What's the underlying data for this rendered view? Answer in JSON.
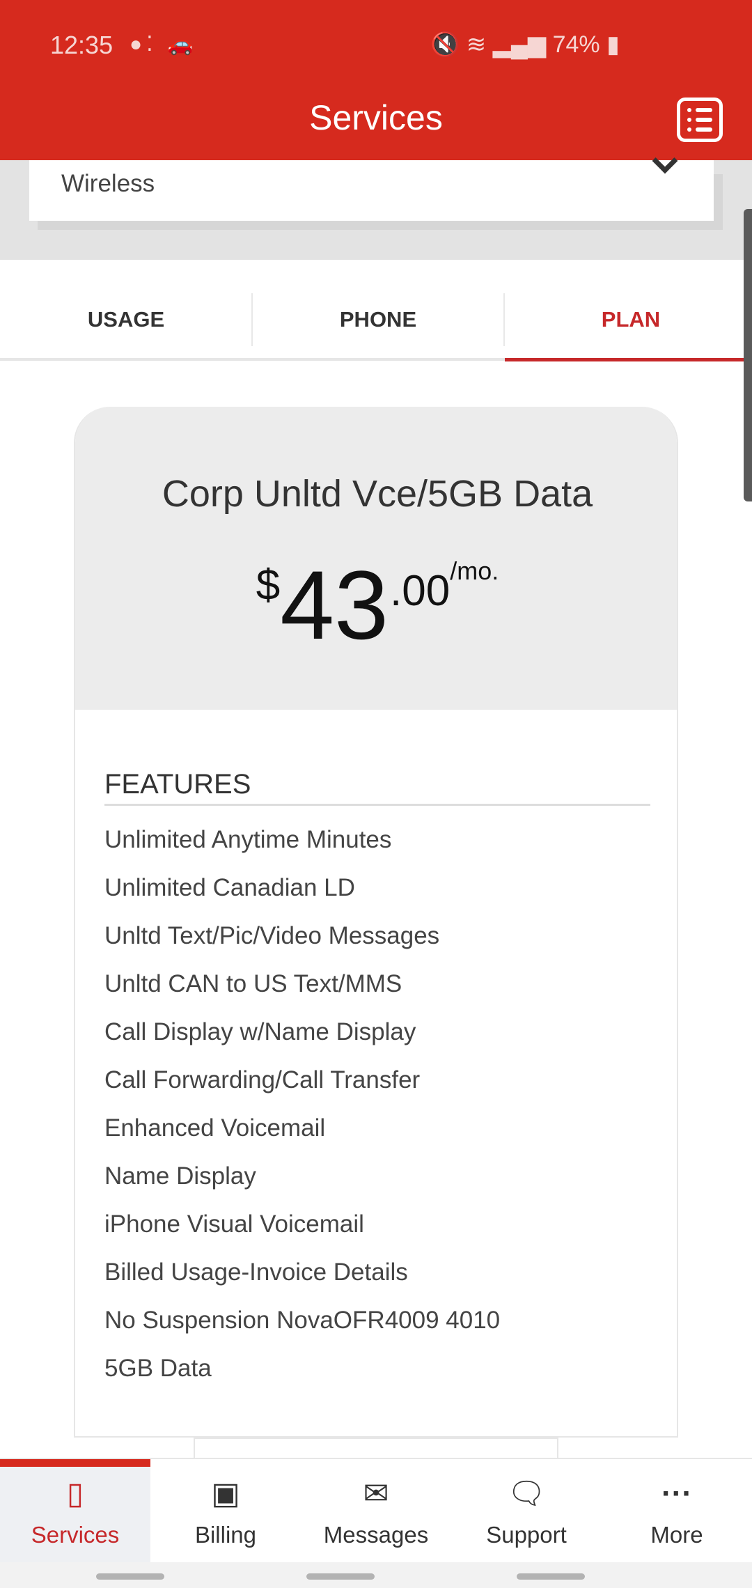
{
  "status_bar": {
    "time": "12:35",
    "battery": "74%",
    "icons": [
      "assistant-icon",
      "car-icon",
      "mute-icon",
      "wifi-icon",
      "signal-icon",
      "battery-icon"
    ]
  },
  "header": {
    "title": "Services",
    "menu_icon": "list-icon"
  },
  "account_select": {
    "value": "Wireless"
  },
  "tabs": [
    {
      "label": "USAGE"
    },
    {
      "label": "PHONE"
    },
    {
      "label": "PLAN",
      "active": true
    }
  ],
  "plan": {
    "name": "Corp Unltd Vce/5GB Data",
    "currency": "$",
    "dollars": "43",
    "cents": ".00",
    "period": "/mo."
  },
  "features": {
    "heading": "FEATURES",
    "items": [
      "Unlimited Anytime Minutes",
      "Unlimited Canadian LD",
      "Unltd Text/Pic/Video Messages",
      "Unltd CAN to US Text/MMS",
      "Call Display w/Name Display",
      "Call Forwarding/Call Transfer",
      "Enhanced Voicemail",
      "Name Display",
      "iPhone Visual Voicemail",
      "Billed Usage-Invoice Details",
      "No Suspension NovaOFR4009 4010",
      "5GB Data"
    ]
  },
  "bottom_nav": [
    {
      "label": "Services",
      "icon": "phone-icon",
      "active": true
    },
    {
      "label": "Billing",
      "icon": "money-icon"
    },
    {
      "label": "Messages",
      "icon": "envelope-icon"
    },
    {
      "label": "Support",
      "icon": "support-chat-icon"
    },
    {
      "label": "More",
      "icon": "more-icon"
    }
  ],
  "colors": {
    "brand": "#d62a1e",
    "active": "#c6282a"
  }
}
